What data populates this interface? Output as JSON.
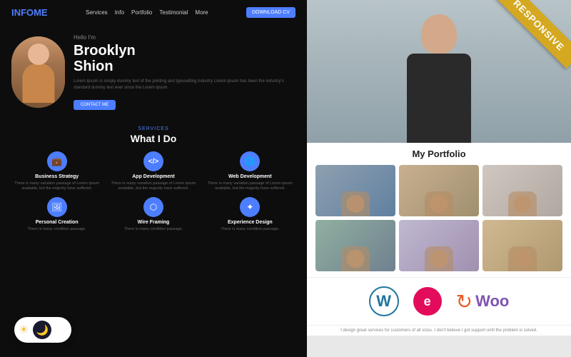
{
  "left_panel": {
    "nav": {
      "logo_text": "INFO",
      "logo_accent": "ME",
      "links": [
        "Services",
        "Info",
        "Portfolio",
        "Testimonial",
        "More"
      ],
      "button_label": "DOWNLOAD CV"
    },
    "hero": {
      "greeting": "Hello I'm",
      "name_line1": "Brooklyn",
      "name_line2": "Shion",
      "description": "Lorem ipsum is simply dummy text of the printing and typesetting industry Lorem ipsum has been the industry's standard dummy text ever since the Lorem ipsum.",
      "button_label": "CONTACT ME"
    },
    "services": {
      "subtitle": "SERVICES",
      "title": "What I Do",
      "items": [
        {
          "icon": "💼",
          "name": "Business Strategy",
          "desc": "There is many variation passage of Lorem ipsum available, but the majority have suffered."
        },
        {
          "icon": "<>",
          "name": "App Development",
          "desc": "There is many variation passage of Lorem ipsum available, but the majority have suffered."
        },
        {
          "icon": "🌐",
          "name": "Web Development",
          "desc": "There is many variation passage of Lorem ipsum available, but the majority have suffered."
        },
        {
          "icon": "🖼",
          "name": "Personal Creation",
          "desc": "There is many condition passage."
        },
        {
          "icon": "⬡",
          "name": "Wire Framing",
          "desc": "There is many condition passage."
        },
        {
          "icon": "✦",
          "name": "Experience Design",
          "desc": "There is many condition passage."
        }
      ]
    },
    "toggle": {
      "mode": "dark"
    }
  },
  "right_panel": {
    "responsive_badge": "RESPONSIVE",
    "portfolio": {
      "title": "My Portfolio",
      "items": [
        {
          "id": 1
        },
        {
          "id": 2
        },
        {
          "id": 3
        },
        {
          "id": 4
        },
        {
          "id": 5
        },
        {
          "id": 6
        }
      ]
    },
    "logos": {
      "wordpress_letter": "W",
      "elementor_letter": "e",
      "woo_text": "Woo"
    },
    "info_text": "I design great services for customers of all sizes. I don't believe I got support until the problem is solved."
  }
}
